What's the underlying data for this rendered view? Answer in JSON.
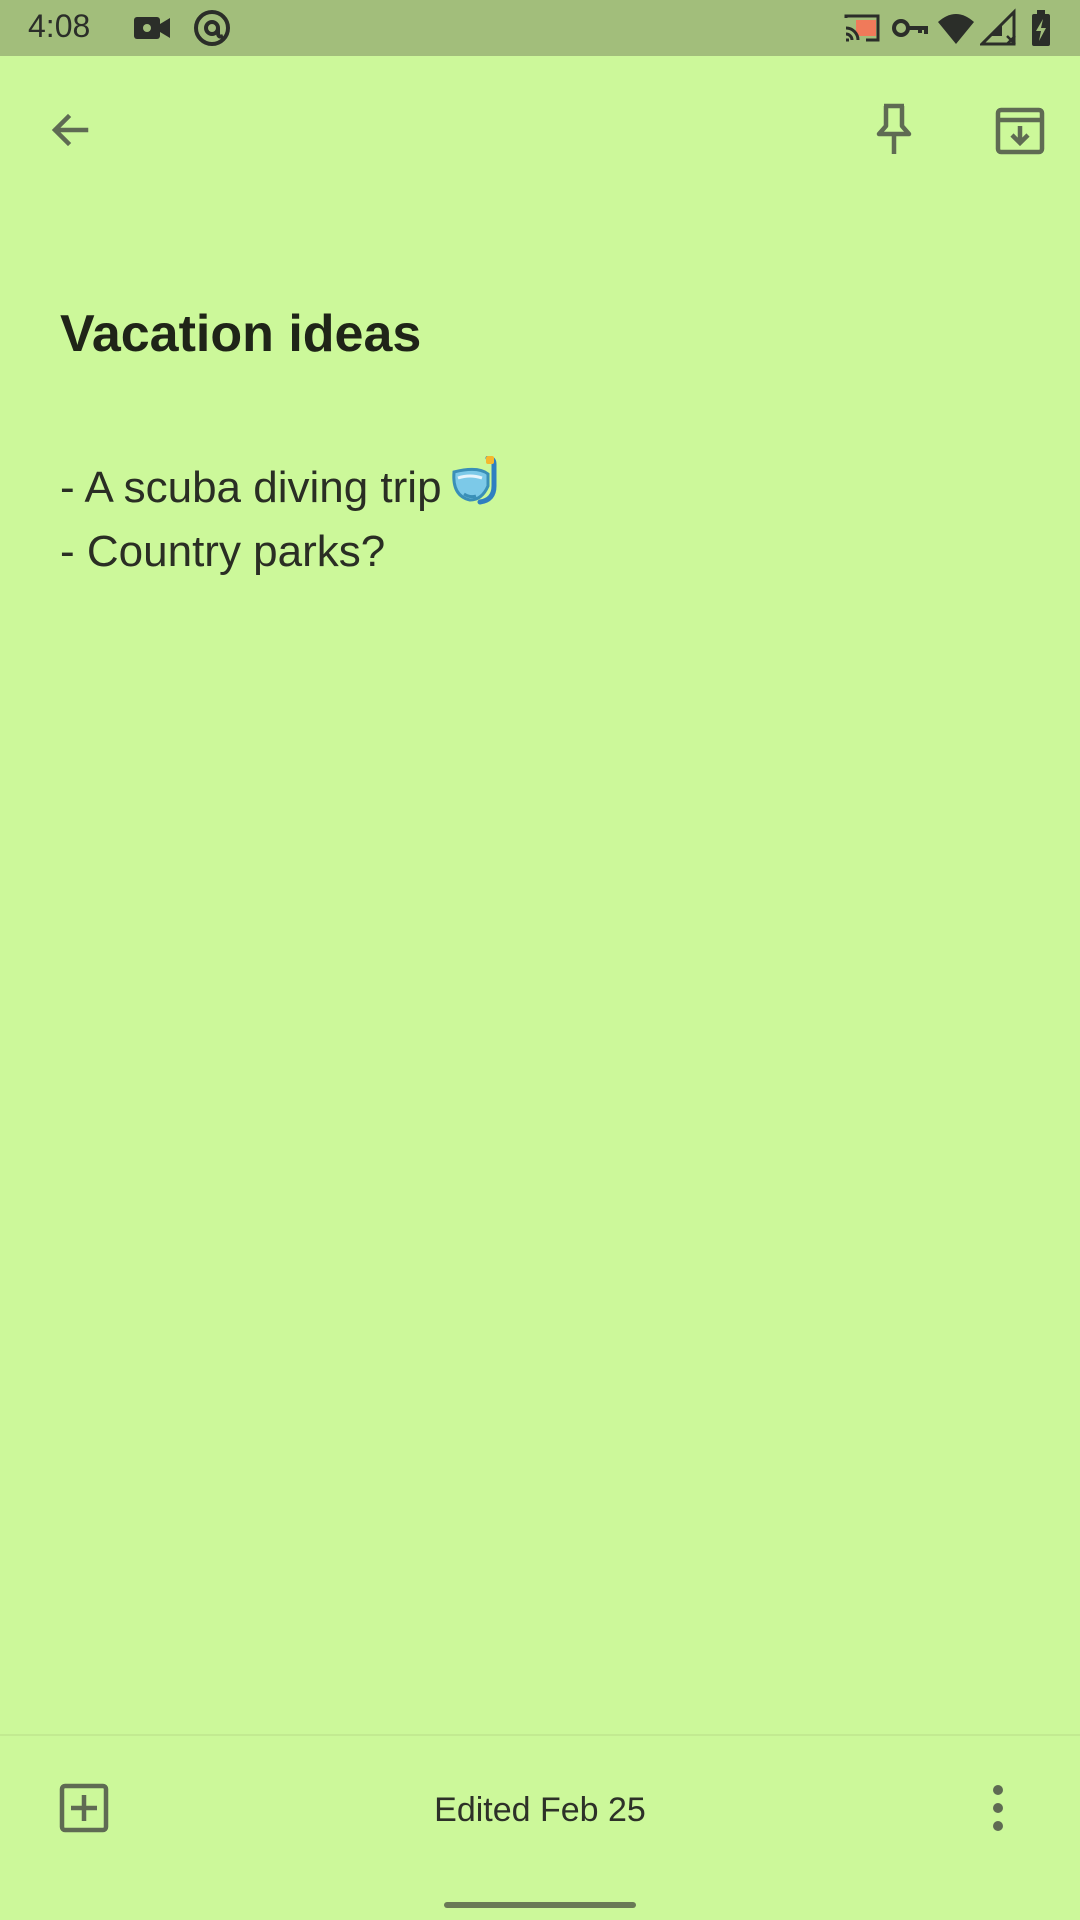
{
  "status_bar": {
    "time": "4:08",
    "icons": [
      "video-camera-icon",
      "at-sign-icon",
      "cast-icon",
      "vpn-key-icon",
      "wifi-icon",
      "cellular-signal-icon",
      "battery-charging-icon"
    ]
  },
  "toolbar": {
    "back_icon": "arrow-left-icon",
    "pin_icon": "pin-icon",
    "archive_icon": "archive-icon"
  },
  "note": {
    "title": "Vacation ideas",
    "lines": [
      {
        "text": "- A scuba diving trip",
        "emoji": "diving-mask-icon"
      },
      {
        "text": "- Country parks?"
      }
    ]
  },
  "bottom_bar": {
    "add_icon": "add-box-icon",
    "edited_label": "Edited Feb 25",
    "more_icon": "more-vertical-icon"
  },
  "colors": {
    "background": "#ccf89a",
    "status_bar": "#a2be7b",
    "icon": "#5f6b53"
  }
}
